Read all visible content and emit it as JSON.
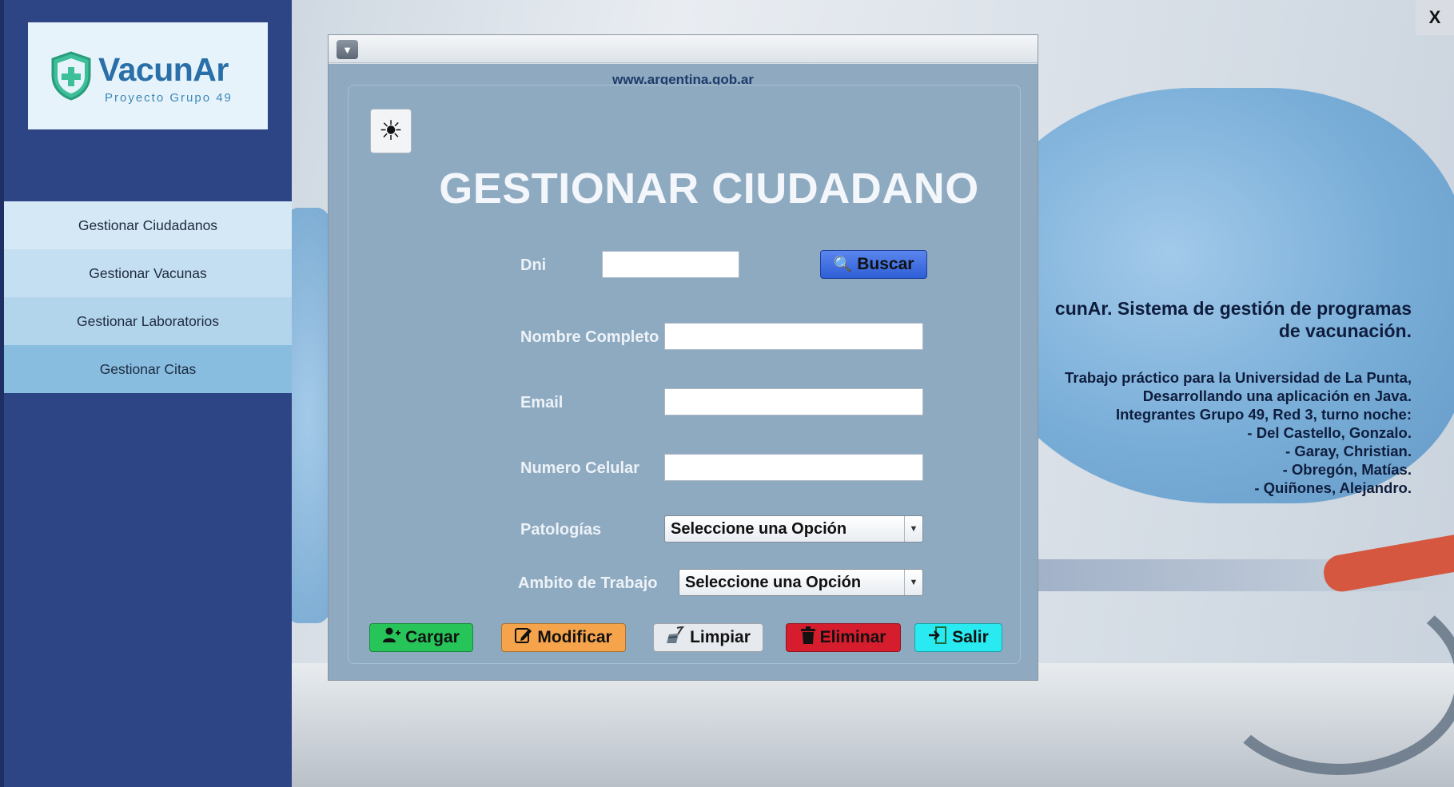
{
  "logo": {
    "title": "VacunAr",
    "subtitle": "Proyecto Grupo 49"
  },
  "sidebar": {
    "items": [
      {
        "label": "Gestionar Ciudadanos"
      },
      {
        "label": "Gestionar Vacunas"
      },
      {
        "label": "Gestionar Laboratorios"
      },
      {
        "label": "Gestionar Citas"
      }
    ]
  },
  "window": {
    "close_label": "X"
  },
  "info": {
    "title_lines": [
      "cunAr. Sistema de gestión de programas",
      "de vacunación."
    ],
    "body_lines": [
      "Trabajo práctico para la Universidad de La Punta,",
      "Desarrollando una aplicación en Java.",
      "Integrantes Grupo 49, Red 3, turno noche:",
      "- Del Castello, Gonzalo.",
      "- Garay, Christian.",
      "- Obregón, Matías.",
      "- Quiñones, Alejandro."
    ]
  },
  "frame": {
    "url": "www.argentina.gob.ar",
    "title": "GESTIONAR CIUDADANO",
    "fields": {
      "dni_label": "Dni",
      "dni_value": "",
      "nombre_label": "Nombre Completo",
      "nombre_value": "",
      "email_label": "Email",
      "email_value": "",
      "celular_label": "Numero Celular",
      "celular_value": "",
      "patologias_label": "Patologías",
      "patologias_selected": "Seleccione una Opción",
      "ambito_label": "Ambito de Trabajo",
      "ambito_selected": "Seleccione una Opción"
    },
    "buttons": {
      "buscar": "Buscar",
      "cargar": "Cargar",
      "modificar": "Modificar",
      "limpiar": "Limpiar",
      "eliminar": "Eliminar",
      "salir": "Salir"
    }
  },
  "colors": {
    "sidebar_bg": "#2e4585",
    "panel_bg": "#8eaac1",
    "buscar": "#2f5fd6",
    "cargar": "#27c45a",
    "modificar": "#f5a44b",
    "limpiar": "#e6eaee",
    "eliminar": "#d51d2e",
    "salir": "#28eaf0"
  },
  "icons": {
    "logo": "shield-plus-icon",
    "theme": "sun-icon",
    "buscar": "magnifier-icon",
    "cargar": "add-user-icon",
    "modificar": "edit-icon",
    "limpiar": "broom-icon",
    "eliminar": "trash-icon",
    "salir": "exit-icon",
    "frame_menu": "chevron-down-icon"
  }
}
